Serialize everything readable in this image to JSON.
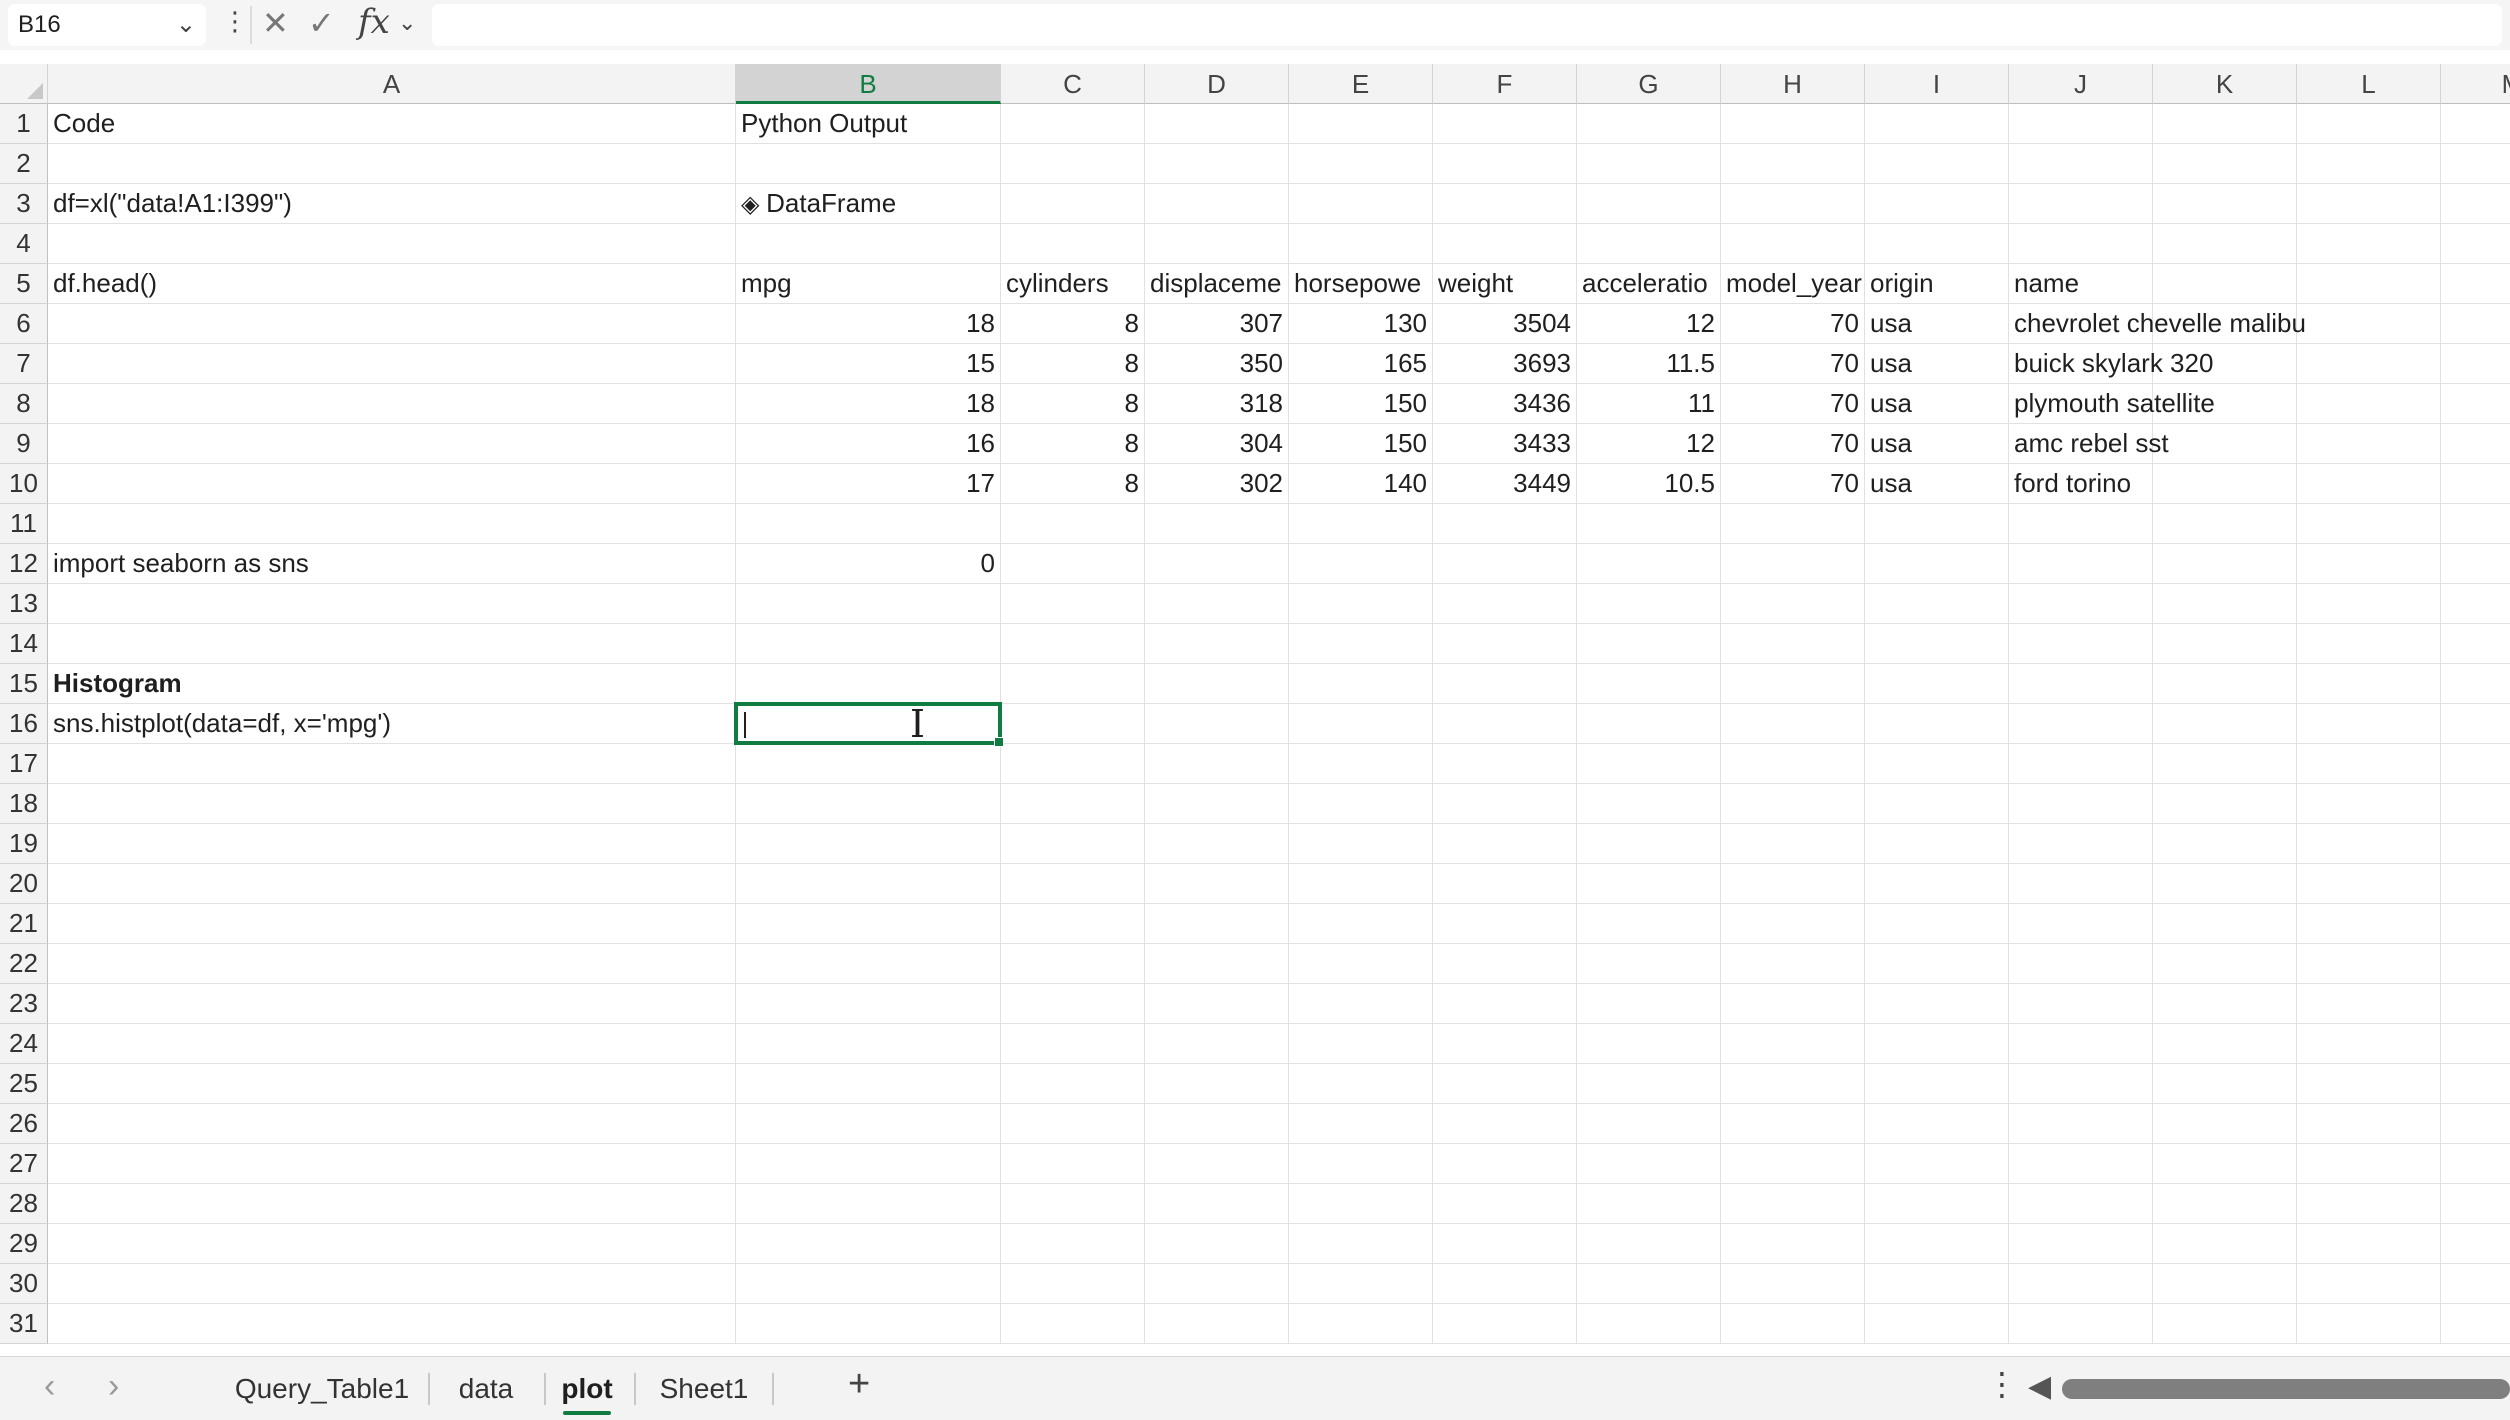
{
  "formula_bar": {
    "name_box": "B16",
    "formula": ""
  },
  "icons": {
    "name_box_dropdown": "chevron-down-icon",
    "more": "more-vertical-icon",
    "cancel": "x-icon",
    "enter": "check-icon",
    "fx": "function-icon",
    "dataframe": "stack-icon",
    "add_sheet": "plus-icon",
    "tabs_more": "more-vertical-icon",
    "scroll_left": "triangle-left-icon"
  },
  "colors": {
    "accent": "#107c41",
    "selected_header_bg": "#d3d3d3"
  },
  "columns": [
    "A",
    "B",
    "C",
    "D",
    "E",
    "F",
    "G",
    "H",
    "I",
    "J",
    "K",
    "L",
    "M"
  ],
  "selected_column": "B",
  "rows": [
    1,
    2,
    3,
    4,
    5,
    6,
    7,
    8,
    9,
    10,
    11,
    12,
    13,
    14,
    15,
    16,
    17,
    18,
    19,
    20,
    21,
    22,
    23,
    24,
    25,
    26,
    27,
    28,
    29,
    30,
    31
  ],
  "cells": {
    "A1": "Code",
    "B1": "Python Output",
    "A3": "df=xl(\"data!A1:I399\")",
    "B3": "DataFrame",
    "A5": "df.head()",
    "B5": "mpg",
    "C5": "cylinders",
    "D5": "displaceme",
    "E5": "horsepowe",
    "F5": "weight",
    "G5": "acceleratio",
    "H5": "model_year",
    "I5": "origin",
    "J5": "name",
    "B6": "18",
    "C6": "8",
    "D6": "307",
    "E6": "130",
    "F6": "3504",
    "G6": "12",
    "H6": "70",
    "I6": "usa",
    "J6": "chevrolet chevelle malibu",
    "B7": "15",
    "C7": "8",
    "D7": "350",
    "E7": "165",
    "F7": "3693",
    "G7": "11.5",
    "H7": "70",
    "I7": "usa",
    "J7": "buick skylark 320",
    "B8": "18",
    "C8": "8",
    "D8": "318",
    "E8": "150",
    "F8": "3436",
    "G8": "11",
    "H8": "70",
    "I8": "usa",
    "J8": "plymouth satellite",
    "B9": "16",
    "C9": "8",
    "D9": "304",
    "E9": "150",
    "F9": "3433",
    "G9": "12",
    "H9": "70",
    "I9": "usa",
    "J9": "amc rebel sst",
    "B10": "17",
    "C10": "8",
    "D10": "302",
    "E10": "140",
    "F10": "3449",
    "G10": "10.5",
    "H10": "70",
    "I10": "usa",
    "J10": "ford torino",
    "A12": "import seaborn as sns",
    "B12": "0",
    "A15": "Histogram",
    "A16": "sns.histplot(data=df, x='mpg')",
    "B16": ""
  },
  "numeric_cells": [
    "B6",
    "C6",
    "D6",
    "E6",
    "F6",
    "G6",
    "H6",
    "B7",
    "C7",
    "D7",
    "E7",
    "F7",
    "G7",
    "H7",
    "B8",
    "C8",
    "D8",
    "E8",
    "F8",
    "G8",
    "H8",
    "B9",
    "C9",
    "D9",
    "E9",
    "F9",
    "G9",
    "H9",
    "B10",
    "C10",
    "D10",
    "E10",
    "F10",
    "G10",
    "H10",
    "B12"
  ],
  "bold_cells": [
    "A15"
  ],
  "spill_cells": [
    "J6",
    "J7",
    "J8",
    "J9",
    "J10"
  ],
  "active_cell": "B16",
  "sheet_tabs": [
    {
      "label": "Query_Table1",
      "active": false
    },
    {
      "label": "data",
      "active": false
    },
    {
      "label": "plot",
      "active": true
    },
    {
      "label": "Sheet1",
      "active": false
    }
  ],
  "add_sheet_label": "+"
}
